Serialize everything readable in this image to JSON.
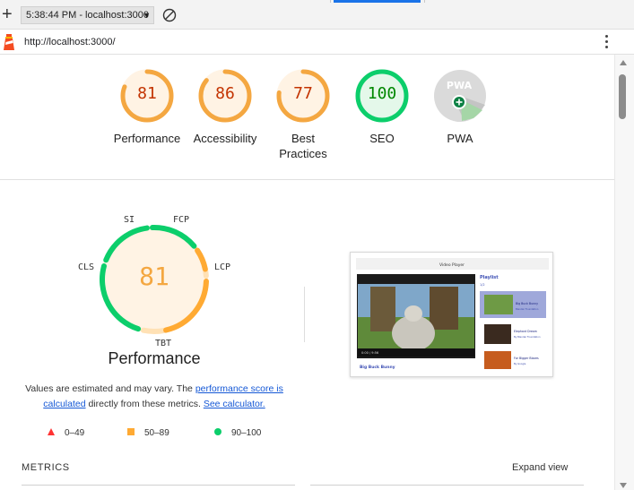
{
  "tabs": {
    "report_select": "5:38:44 PM - localhost:3000"
  },
  "url": "http://localhost:3000/",
  "gauges": [
    {
      "label": "Performance",
      "score": "81",
      "value": 81,
      "color": "#f4a741",
      "text_color": "#c33300"
    },
    {
      "label": "Accessibility",
      "score": "86",
      "value": 86,
      "color": "#f4a741",
      "text_color": "#c33300"
    },
    {
      "label": "Best Practices",
      "score": "77",
      "value": 77,
      "color": "#f4a741",
      "text_color": "#c33300"
    },
    {
      "label": "SEO",
      "score": "100",
      "value": 100,
      "color": "#0cce6b",
      "text_color": "#008800"
    },
    {
      "label": "PWA",
      "score": "PWA",
      "value": 0,
      "color": "#9e9e9e",
      "text_color": "#ffffff"
    }
  ],
  "performance": {
    "score": "81",
    "title": "Performance",
    "metrics": [
      "SI",
      "FCP",
      "LCP",
      "TBT",
      "CLS"
    ],
    "note_prefix": "Values are estimated and may vary. The ",
    "note_link1": "performance score is calculated",
    "note_middle": " directly from these metrics. ",
    "note_link2": "See calculator."
  },
  "legend": [
    {
      "range": "0–49",
      "color": "#ff3333",
      "shape": "triangle"
    },
    {
      "range": "50–89",
      "color": "#ffaa33",
      "shape": "square"
    },
    {
      "range": "90–100",
      "color": "#0cce6b",
      "shape": "circle"
    }
  ],
  "screenshot": {
    "header": "Video Player",
    "playlist_title": "Playlist",
    "playlist_sub": "1/2",
    "items": [
      "Big Buck Bunny",
      "Elephant Dream",
      "For Bigger Blazes"
    ],
    "item_subs": [
      "Blender Foundation",
      "By Blender Foundation",
      "By Google"
    ],
    "caption": "Big Buck Bunny",
    "time": "0:00 / 9:56"
  },
  "footer": {
    "metrics_title": "METRICS",
    "expand_label": "Expand view"
  }
}
